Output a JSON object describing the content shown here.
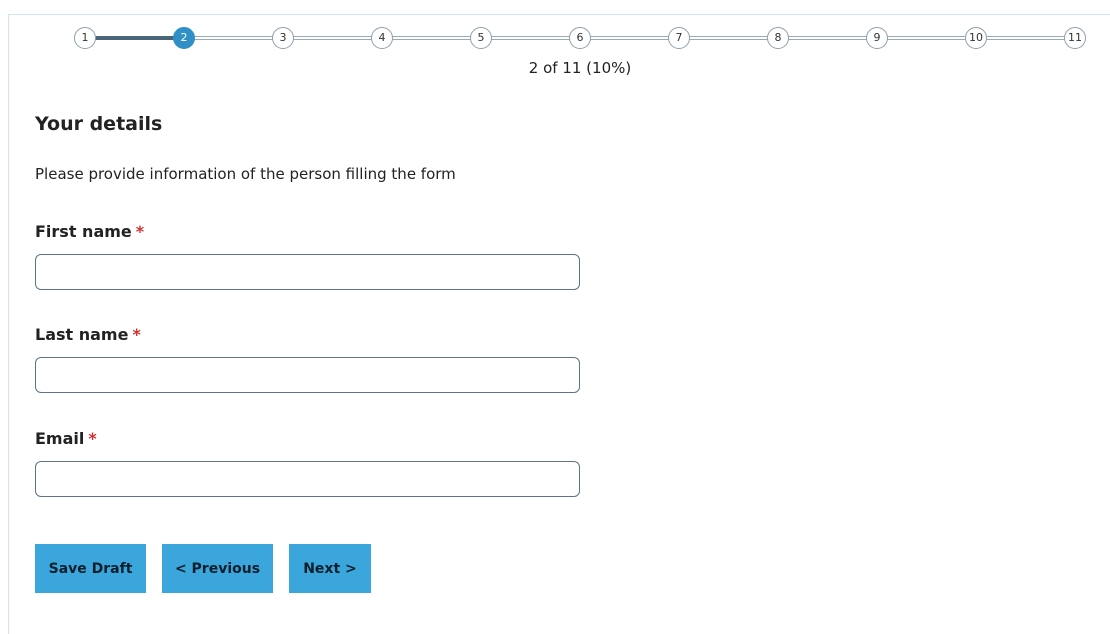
{
  "stepper": {
    "steps": [
      "1",
      "2",
      "3",
      "4",
      "5",
      "6",
      "7",
      "8",
      "9",
      "10",
      "11"
    ],
    "current_step": 2,
    "progress_text": "2 of 11 (10%)",
    "progress_fraction": 0.1
  },
  "form": {
    "title": "Your details",
    "intro": "Please provide information of the person filling the form",
    "required_marker": "*",
    "fields": [
      {
        "label": "First name",
        "value": ""
      },
      {
        "label": "Last name",
        "value": ""
      },
      {
        "label": "Email",
        "value": ""
      }
    ]
  },
  "buttons": {
    "save_draft": "Save Draft",
    "previous": "< Previous",
    "next": "Next >"
  },
  "colors": {
    "accent": "#2f8fc6",
    "button_bg": "#3aa6dc",
    "required": "#d32f2f"
  }
}
